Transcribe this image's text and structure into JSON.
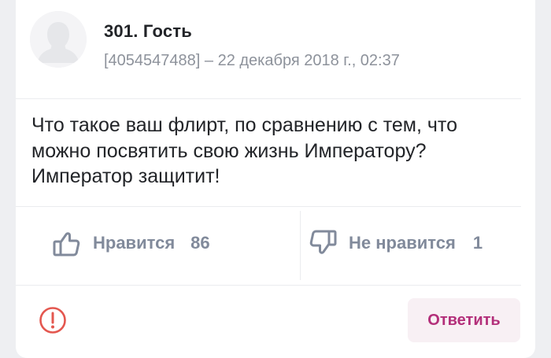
{
  "comment": {
    "author": "301. Гость",
    "meta": "[4054547488] – 22 декабря 2018 г., 02:37",
    "text": "Что такое ваш флирт, по сравнению с тем, что можно посвятить свою жизнь Императору? Император защитит!"
  },
  "votes": {
    "like_label": "Нравится",
    "like_count": "86",
    "dislike_label": "Не нравится",
    "dislike_count": "1"
  },
  "actions": {
    "reply_label": "Ответить"
  },
  "icons": {
    "avatar": "default-user-silhouette",
    "like": "thumbs-up-icon",
    "dislike": "thumbs-down-icon",
    "report": "warning-circle-icon"
  },
  "colors": {
    "accent": "#b32f7a",
    "vote_text": "#818a9b",
    "report": "#e4574f",
    "meta_text": "#8d929b"
  }
}
